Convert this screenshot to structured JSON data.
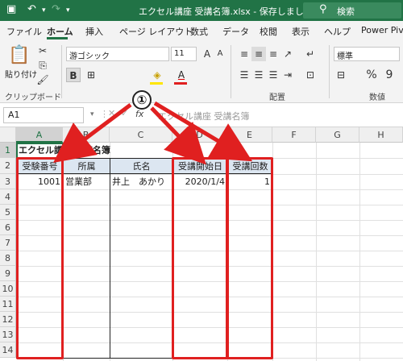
{
  "window": {
    "title": "エクセル講座 受講名簿.xlsx - 保存しました",
    "search_label": "検索"
  },
  "menu": {
    "tabs": [
      "ファイル",
      "ホーム",
      "挿入",
      "ページ レイアウト",
      "数式",
      "データ",
      "校閲",
      "表示",
      "ヘルプ",
      "Power Pivo"
    ],
    "active": "ホーム"
  },
  "ribbon": {
    "paste_label": "貼り付け",
    "clipboard_label": "クリップボード",
    "font_name": "游ゴシック",
    "font_size": "11",
    "bold": "B",
    "underline_letter": "A",
    "align_label": "配置",
    "number_format": "標準",
    "number_label": "数値",
    "percent": "%",
    "comma": "9"
  },
  "formula_bar": {
    "name_box": "A1",
    "fx": "fx",
    "content": "エクセル講座 受講名簿"
  },
  "grid": {
    "columns": [
      "A",
      "B",
      "C",
      "D",
      "E",
      "F",
      "G",
      "H"
    ],
    "rows": [
      "1",
      "2",
      "3",
      "4",
      "5",
      "6",
      "7",
      "8",
      "9",
      "10",
      "11",
      "12",
      "13",
      "14"
    ],
    "selected_col": "A",
    "selected_row": "1"
  },
  "sheet": {
    "title_cell": "エクセル講座 受講名簿",
    "headers": [
      "受験番号",
      "所属",
      "氏名",
      "受講開始日",
      "受講回数"
    ],
    "row3": [
      "1001",
      "営業部",
      "井上　あかり",
      "2020/1/4",
      "1"
    ]
  },
  "annotation": {
    "callout_label": "①",
    "color": "#e02020"
  }
}
